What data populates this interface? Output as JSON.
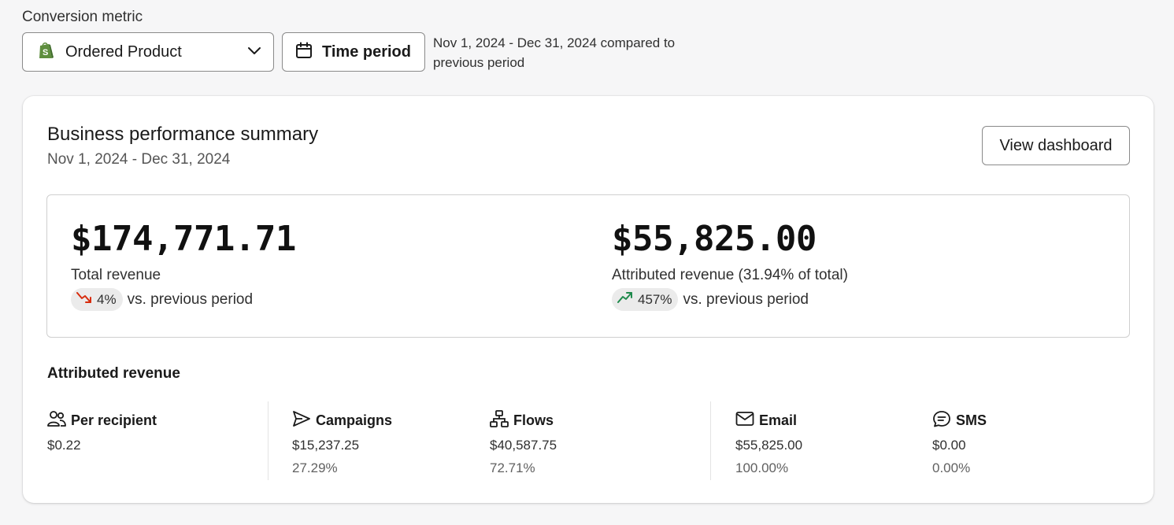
{
  "controls": {
    "metric_label": "Conversion metric",
    "metric_value": "Ordered Product",
    "time_period_label": "Time period",
    "period_description": "Nov 1, 2024 - Dec 31, 2024 compared to previous period"
  },
  "summary": {
    "title": "Business performance summary",
    "date_range": "Nov 1, 2024 - Dec 31, 2024",
    "view_dashboard_label": "View dashboard",
    "total": {
      "value": "$174,771.71",
      "label": "Total revenue",
      "change": "4%",
      "direction": "down",
      "compare_text": "vs. previous period"
    },
    "attributed": {
      "value": "$55,825.00",
      "label": "Attributed revenue (31.94% of total)",
      "change": "457%",
      "direction": "up",
      "compare_text": "vs. previous period"
    }
  },
  "attributed_revenue": {
    "title": "Attributed revenue",
    "per_recipient": {
      "label": "Per recipient",
      "value": "$0.22",
      "icon": "users-icon"
    },
    "campaigns": {
      "label": "Campaigns",
      "value": "$15,237.25",
      "percent": "27.29%",
      "icon": "send-icon"
    },
    "flows": {
      "label": "Flows",
      "value": "$40,587.75",
      "percent": "72.71%",
      "icon": "flow-icon"
    },
    "email": {
      "label": "Email",
      "value": "$55,825.00",
      "percent": "100.00%",
      "icon": "email-icon"
    },
    "sms": {
      "label": "SMS",
      "value": "$0.00",
      "percent": "0.00%",
      "icon": "sms-icon"
    }
  },
  "colors": {
    "down": "#d72c0d",
    "up": "#1f8a4c",
    "shopify_green": "#5e8e3e"
  }
}
